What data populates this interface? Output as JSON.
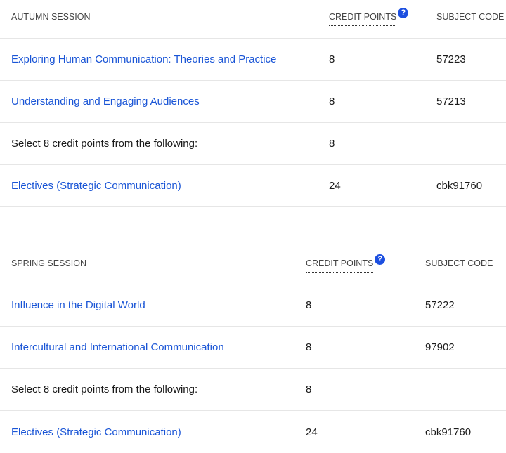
{
  "autumn": {
    "header": {
      "session": "AUTUMN SESSION",
      "credit_points": "CREDIT POINTS",
      "help": "?",
      "subject_code": "SUBJECT CODE"
    },
    "rows": [
      {
        "title": "Exploring Human Communication: Theories and Practice",
        "credits": "8",
        "code": "57223"
      },
      {
        "title": "Understanding and Engaging Audiences",
        "credits": "8",
        "code": "57213"
      },
      {
        "title": "Select 8 credit points from the following:",
        "credits": "8",
        "code": ""
      },
      {
        "title": "Electives (Strategic Communication)",
        "credits": "24",
        "code": "cbk91760"
      }
    ]
  },
  "spring": {
    "header": {
      "session": "SPRING SESSION",
      "credit_points": "CREDIT POINTS",
      "help": "?",
      "subject_code": "SUBJECT CODE"
    },
    "rows": [
      {
        "title": "Influence in the Digital World",
        "credits": "8",
        "code": "57222"
      },
      {
        "title": "Intercultural and International Communication",
        "credits": "8",
        "code": "97902"
      },
      {
        "title": "Select 8 credit points from the following:",
        "credits": "8",
        "code": ""
      },
      {
        "title": "Electives (Strategic Communication)",
        "credits": "24",
        "code": "cbk91760"
      }
    ]
  },
  "colors": {
    "link": "#1a55d6",
    "help_badge": "#1c4fe0",
    "divider": "#e6e6e6"
  }
}
